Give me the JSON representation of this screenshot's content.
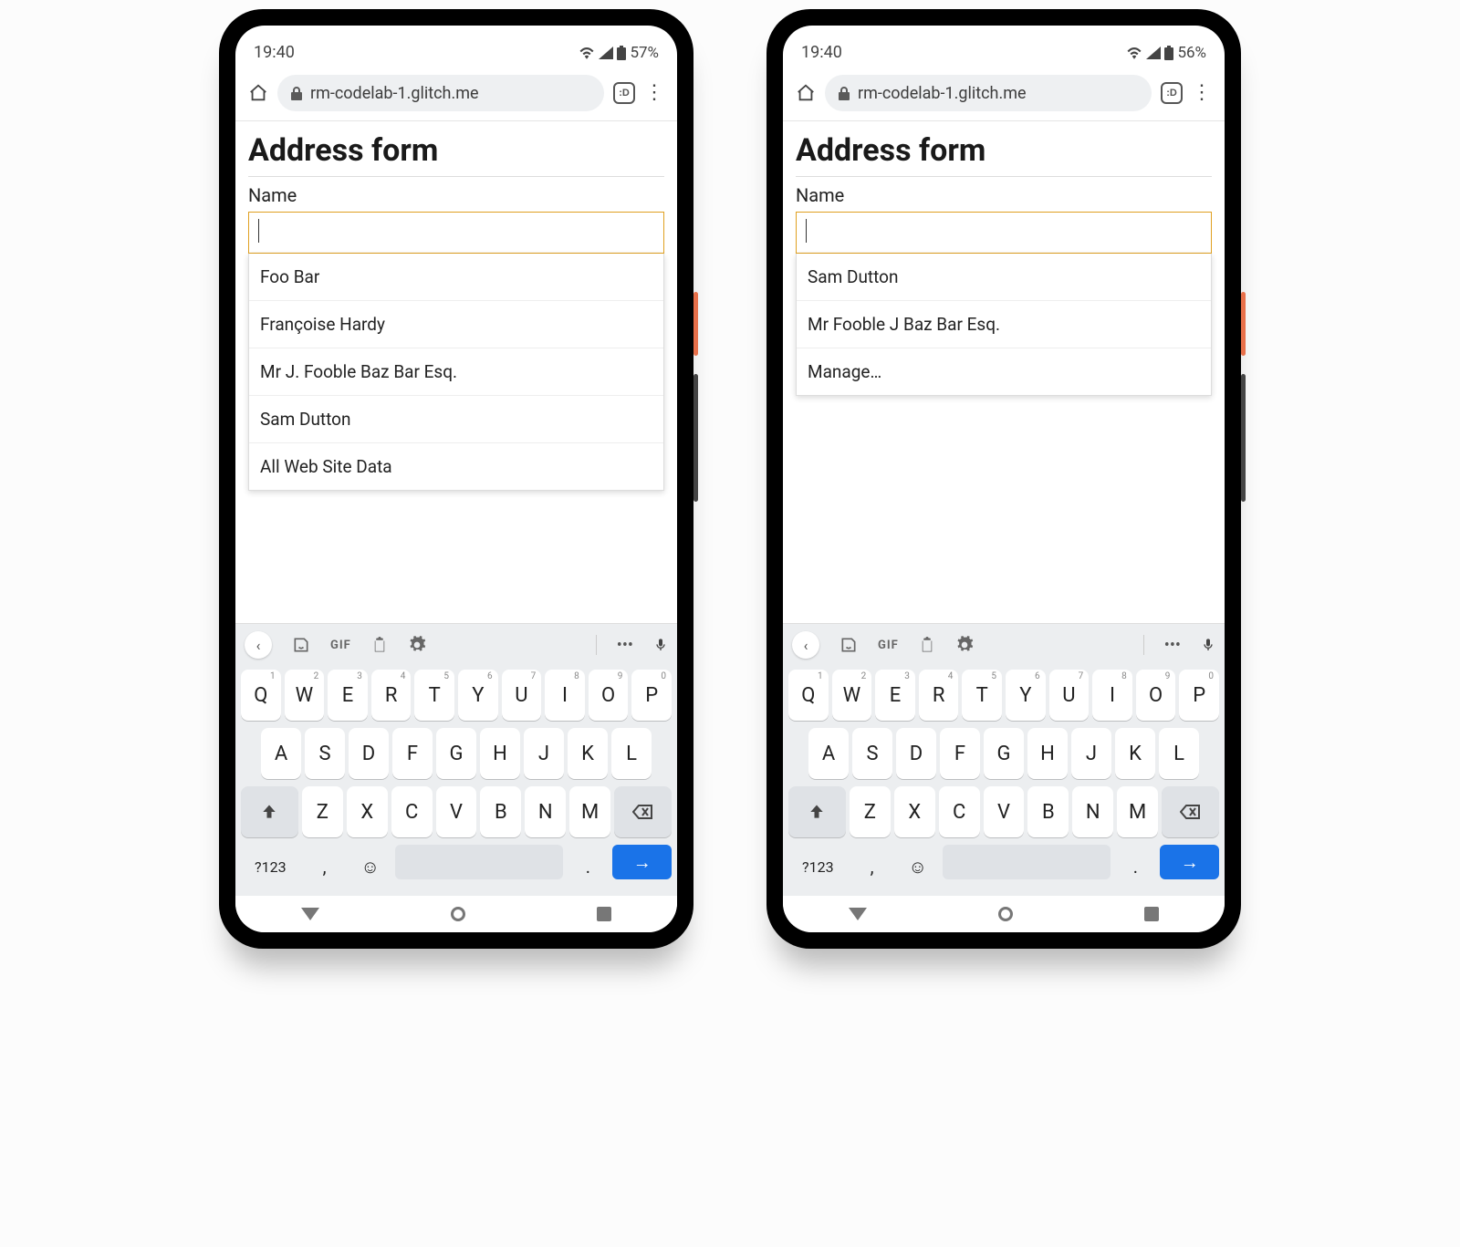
{
  "phones": [
    {
      "status": {
        "time": "19:40",
        "battery": "57%"
      },
      "browser": {
        "url": "rm-codelab-1.glitch.me",
        "tab_count": ":D"
      },
      "page": {
        "title": "Address form",
        "field_label": "Name",
        "input_value": ""
      },
      "suggestions": [
        "Foo Bar",
        "Françoise Hardy",
        "Mr J. Fooble Baz Bar Esq.",
        "Sam Dutton",
        "All Web Site Data"
      ]
    },
    {
      "status": {
        "time": "19:40",
        "battery": "56%"
      },
      "browser": {
        "url": "rm-codelab-1.glitch.me",
        "tab_count": ":D"
      },
      "page": {
        "title": "Address form",
        "field_label": "Name",
        "input_value": ""
      },
      "suggestions": [
        "Sam Dutton",
        "Mr Fooble J Baz Bar Esq.",
        "Manage…"
      ]
    }
  ],
  "keyboard": {
    "row1": [
      "Q",
      "W",
      "E",
      "R",
      "T",
      "Y",
      "U",
      "I",
      "O",
      "P"
    ],
    "row1_sup": [
      "1",
      "2",
      "3",
      "4",
      "5",
      "6",
      "7",
      "8",
      "9",
      "0"
    ],
    "row2": [
      "A",
      "S",
      "D",
      "F",
      "G",
      "H",
      "J",
      "K",
      "L"
    ],
    "row3": [
      "Z",
      "X",
      "C",
      "V",
      "B",
      "N",
      "M"
    ],
    "sym_key": "?123",
    "comma": ",",
    "period": ".",
    "gif_label": "GIF"
  }
}
